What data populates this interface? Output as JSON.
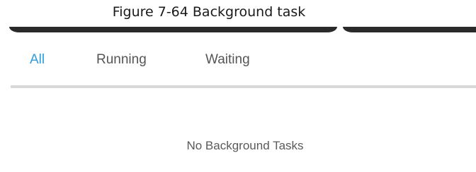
{
  "caption": "Figure 7-64 Background task",
  "tabs": [
    {
      "label": "All",
      "active": true
    },
    {
      "label": "Running",
      "active": false
    },
    {
      "label": "Waiting",
      "active": false
    }
  ],
  "empty_message": "No Background Tasks",
  "colors": {
    "active_tab": "#2d9bdf",
    "inactive_tab": "#555555",
    "divider": "#d9d9d9"
  }
}
